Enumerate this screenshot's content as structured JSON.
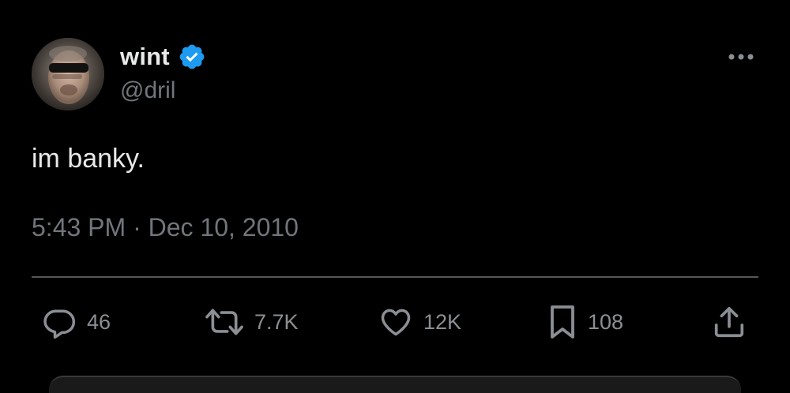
{
  "author": {
    "name": "wint",
    "handle": "@dril",
    "verified": true,
    "avatar_icon": "user-avatar",
    "verified_color": "#1d9bf0"
  },
  "menu": {
    "more_icon": "more-horizontal-icon"
  },
  "tweet": {
    "text": "im banky.",
    "time": "5:43 PM",
    "separator": "·",
    "date": "Dec 10, 2010"
  },
  "actions": {
    "replies": {
      "icon": "reply-icon",
      "count": "46"
    },
    "retweets": {
      "icon": "retweet-icon",
      "count": "7.7K"
    },
    "likes": {
      "icon": "heart-icon",
      "count": "12K"
    },
    "bookmarks": {
      "icon": "bookmark-icon",
      "count": "108"
    },
    "share": {
      "icon": "share-icon"
    }
  },
  "colors": {
    "background": "#000000",
    "primary_text": "#e7e9ea",
    "secondary_text": "#71767b",
    "divider": "#5b5550"
  }
}
